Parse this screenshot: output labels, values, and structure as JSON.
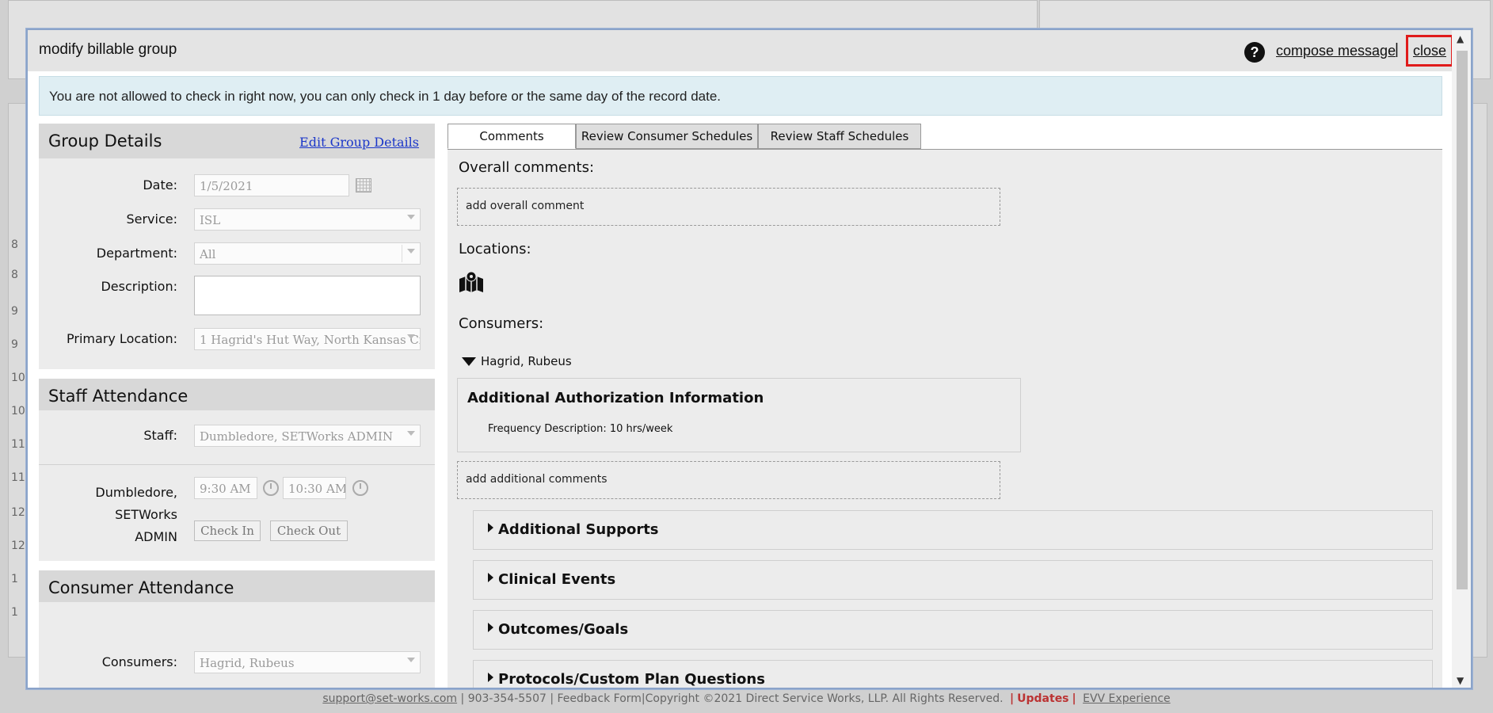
{
  "footer": {
    "support_email": "support@set-works.com",
    "phone": "903-354-5507",
    "feedback": "Feedback Form",
    "copyright": "Copyright ©2021 Direct Service Works, LLP. All Rights Reserved.",
    "updates": "Updates",
    "evv": "EVV Experience"
  },
  "background_row_numbers": [
    "8",
    "8",
    "9",
    "9",
    "10",
    "10",
    "11",
    "11",
    "12",
    "12",
    "1",
    "1"
  ],
  "dialog": {
    "title": "modify billable group",
    "help_symbol": "?",
    "compose_label": "compose message",
    "pipe": "|",
    "close_label": "close",
    "alert_text": "You are not allowed to check in right now, you can only check in 1 day before or the same day of the record date.",
    "accent_close_border": "#e01b1b"
  },
  "group_details": {
    "heading": "Group Details",
    "edit_link": "Edit Group Details",
    "date_label": "Date:",
    "date_value": "1/5/2021",
    "service_label": "Service:",
    "service_value": "ISL",
    "department_label": "Department:",
    "department_value": "All",
    "description_label": "Description:",
    "primary_location_label": "Primary Location:",
    "primary_location_value": "1 Hagrid's Hut Way, North Kansas Ci"
  },
  "staff_attendance": {
    "heading": "Staff Attendance",
    "staff_label": "Staff:",
    "staff_value": "Dumbledore, SETWorks ADMIN",
    "staff_name_line1": "Dumbledore, SETWorks",
    "staff_name_line2": "ADMIN",
    "time_in": "9:30 AM",
    "time_out": "10:30 AM",
    "check_in": "Check In",
    "check_out": "Check Out"
  },
  "consumer_attendance": {
    "heading": "Consumer Attendance",
    "consumers_label": "Consumers:",
    "consumers_value": "Hagrid, Rubeus"
  },
  "tabs": [
    "Comments",
    "Review Consumer Schedules",
    "Review Staff Schedules"
  ],
  "comments": {
    "overall_label": "Overall comments:",
    "add_overall": "add overall comment",
    "locations_label": "Locations:",
    "consumers_label": "Consumers:",
    "consumer_name": "Hagrid, Rubeus",
    "auth_title": "Additional Authorization Information",
    "freq_desc": "Frequency Description: 10 hrs/week",
    "add_additional": "add additional comments",
    "sections": [
      "Additional Supports",
      "Clinical Events",
      "Outcomes/Goals",
      "Protocols/Custom Plan Questions"
    ]
  }
}
